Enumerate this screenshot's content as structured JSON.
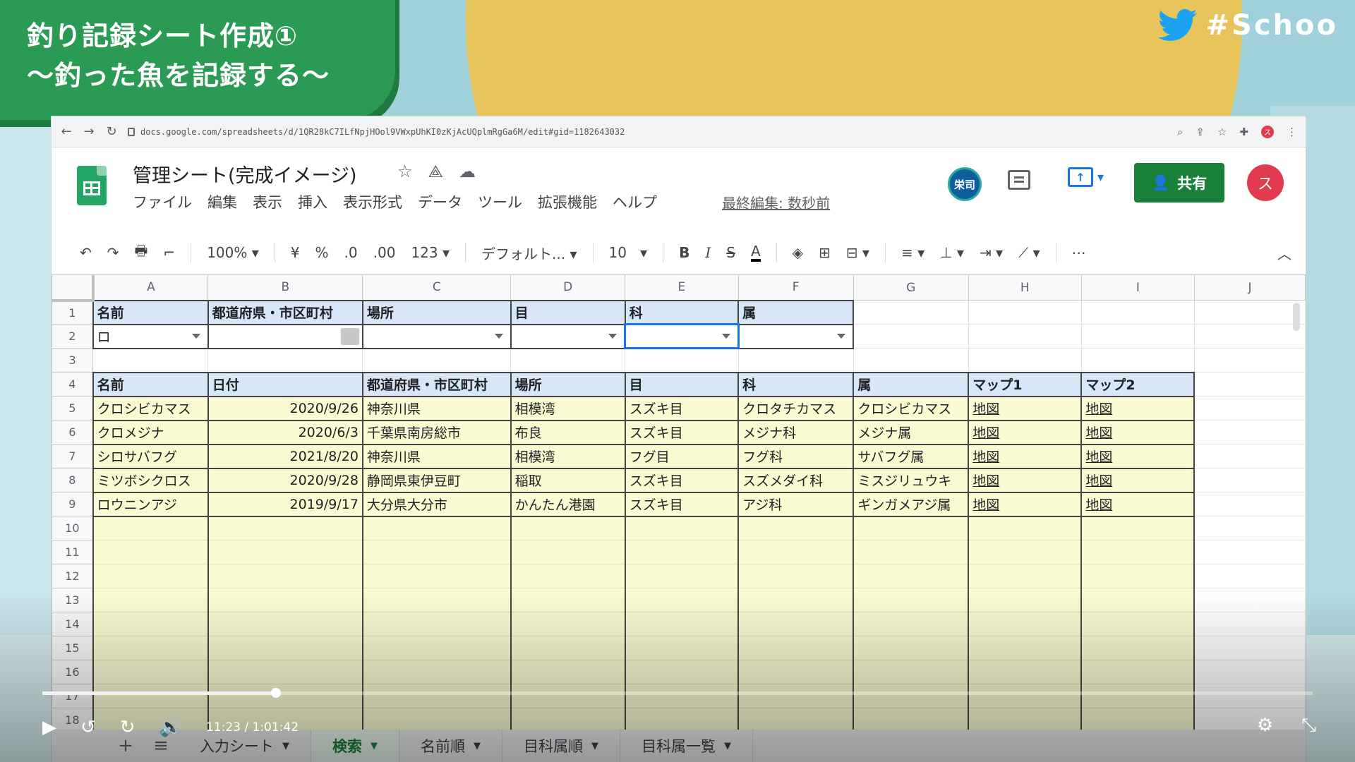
{
  "overlay": {
    "title_line1": "釣り記録シート作成①",
    "title_line2": "〜釣った魚を記録する〜",
    "hashtag": "#Schoo"
  },
  "browser": {
    "url": "docs.google.com/spreadsheets/d/1QR28kC7ILfNpjHOol9VWxpUhKI0zKjAcUQplmRgGa6M/edit#gid=1182643032",
    "profile_initial": "ス"
  },
  "sheets": {
    "doc_title": "管理シート(完成イメージ)",
    "menu": [
      "ファイル",
      "編集",
      "表示",
      "挿入",
      "表示形式",
      "データ",
      "ツール",
      "拡張機能",
      "ヘルプ"
    ],
    "last_edit": "最終編集: 数秒前",
    "user_badge": "栄司",
    "share_label": "共有",
    "account_initial": "ス"
  },
  "toolbar": {
    "undo": "↶",
    "redo": "↷",
    "print": "🖶",
    "paint": "⌐",
    "zoom": "100%",
    "currency": "¥",
    "percent": "%",
    "dec_less": ".0",
    "dec_more": ".00",
    "format_more": "123",
    "font": "デフォルト...",
    "font_size": "10",
    "bold": "B",
    "italic": "I",
    "strike": "S",
    "text_color": "A",
    "more": "⋯"
  },
  "columns": [
    "A",
    "B",
    "C",
    "D",
    "E",
    "F",
    "G",
    "H",
    "I",
    "J"
  ],
  "rows": {
    "r1": [
      "名前",
      "都道府県・市区町村",
      "場所",
      "目",
      "科",
      "属"
    ],
    "r2_a": "ロ",
    "r4": [
      "名前",
      "日付",
      "都道府県・市区町村",
      "場所",
      "目",
      "科",
      "属",
      "マップ1",
      "マップ2"
    ],
    "data": [
      [
        "クロシビカマス",
        "2020/9/26",
        "神奈川県",
        "相模湾",
        "スズキ目",
        "クロタチカマス",
        "クロシビカマス",
        "地図",
        "地図"
      ],
      [
        "クロメジナ",
        "2020/6/3",
        "千葉県南房総市",
        "布良",
        "スズキ目",
        "メジナ科",
        "メジナ属",
        "地図",
        "地図"
      ],
      [
        "シロサバフグ",
        "2021/8/20",
        "神奈川県",
        "相模湾",
        "フグ目",
        "フグ科",
        "サバフグ属",
        "地図",
        "地図"
      ],
      [
        "ミツボシクロス",
        "2020/9/28",
        "静岡県東伊豆町",
        "稲取",
        "スズキ目",
        "スズメダイ科",
        "ミスジリュウキ",
        "地図",
        "地図"
      ],
      [
        "ロウニンアジ",
        "2019/9/17",
        "大分県大分市",
        "かんたん港園",
        "スズキ目",
        "アジ科",
        "ギンガメアジ属",
        "地図",
        "地図"
      ]
    ],
    "row_numbers": [
      "1",
      "2",
      "3",
      "4",
      "5",
      "6",
      "7",
      "8",
      "9",
      "10",
      "11",
      "12",
      "13",
      "14",
      "15",
      "16",
      "17",
      "18"
    ]
  },
  "tabs": {
    "add": "+",
    "list": "≡",
    "items": [
      "入力シート",
      "検索",
      "名前順",
      "目科属順",
      "目科属一覧"
    ],
    "active_index": 1
  },
  "player": {
    "current_time": "11:23",
    "separator": "/",
    "total_time": "1:01:42",
    "progress_fraction": 0.184,
    "play": "▶",
    "rewind": "↺",
    "forward": "↻",
    "volume": "🔊",
    "settings": "⚙",
    "fullscreen": "⤡"
  },
  "colors": {
    "badge_green": "#2a9a55",
    "header_blue": "#d7e7f7",
    "data_yellow": "#fafad2",
    "share_green": "#188038",
    "link_blue": "#1155cc"
  }
}
